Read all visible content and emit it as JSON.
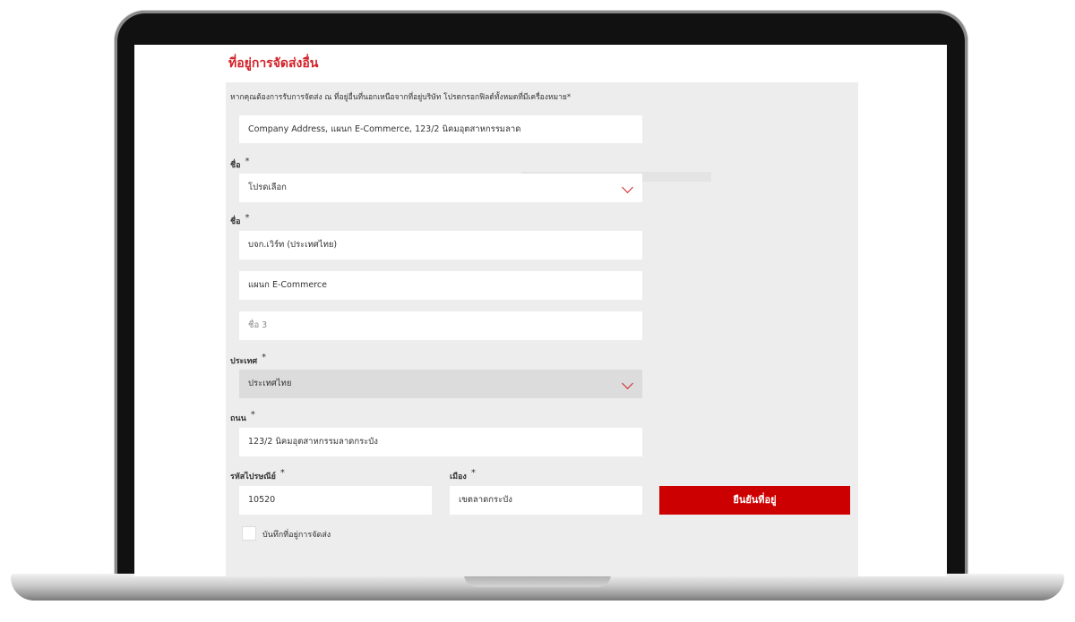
{
  "section_title": "ที่อยู่การจัดส่งอื่น",
  "instruction": "หากคุณต้องการรับการจัดส่ง ณ ที่อยู่อื่นที่นอกเหนือจากที่อยู่บริษัท โปรดกรอกฟิลด์ทั้งหมดที่มีเครื่องหมาย*",
  "address_field": {
    "value": "Company Address, แผนก E-Commerce, 123/2 นิคมอุตสาหกรรมลาด"
  },
  "name_select": {
    "label": "ชื่อ",
    "star": "*",
    "value": "โปรดเลือก"
  },
  "name_group": {
    "label": "ชื่อ",
    "star": "*",
    "line1": "บจก.เวิร์ท (ประเทศไทย)",
    "line2": "แผนก E-Commerce",
    "line3_placeholder": "ชื่อ 3"
  },
  "country": {
    "label": "ประเทศ",
    "star": "*",
    "value": "ประเทศไทย"
  },
  "street": {
    "label": "ถนน",
    "star": "*",
    "value": "123/2 นิคมอุตสาหกรรมลาดกระบัง"
  },
  "postcode": {
    "label": "รหัสไปรษณีย์",
    "star": "*",
    "value": "10520"
  },
  "city": {
    "label": "เมือง",
    "star": "*",
    "value": "เขตลาดกระบัง"
  },
  "check_address_button": "ยืนยันที่อยู่",
  "save_checkbox_label": "บันทึกที่อยู่การจัดส่ง",
  "colors": {
    "accent": "#cc0000",
    "heading": "#d31f26",
    "panel": "#ededed"
  }
}
